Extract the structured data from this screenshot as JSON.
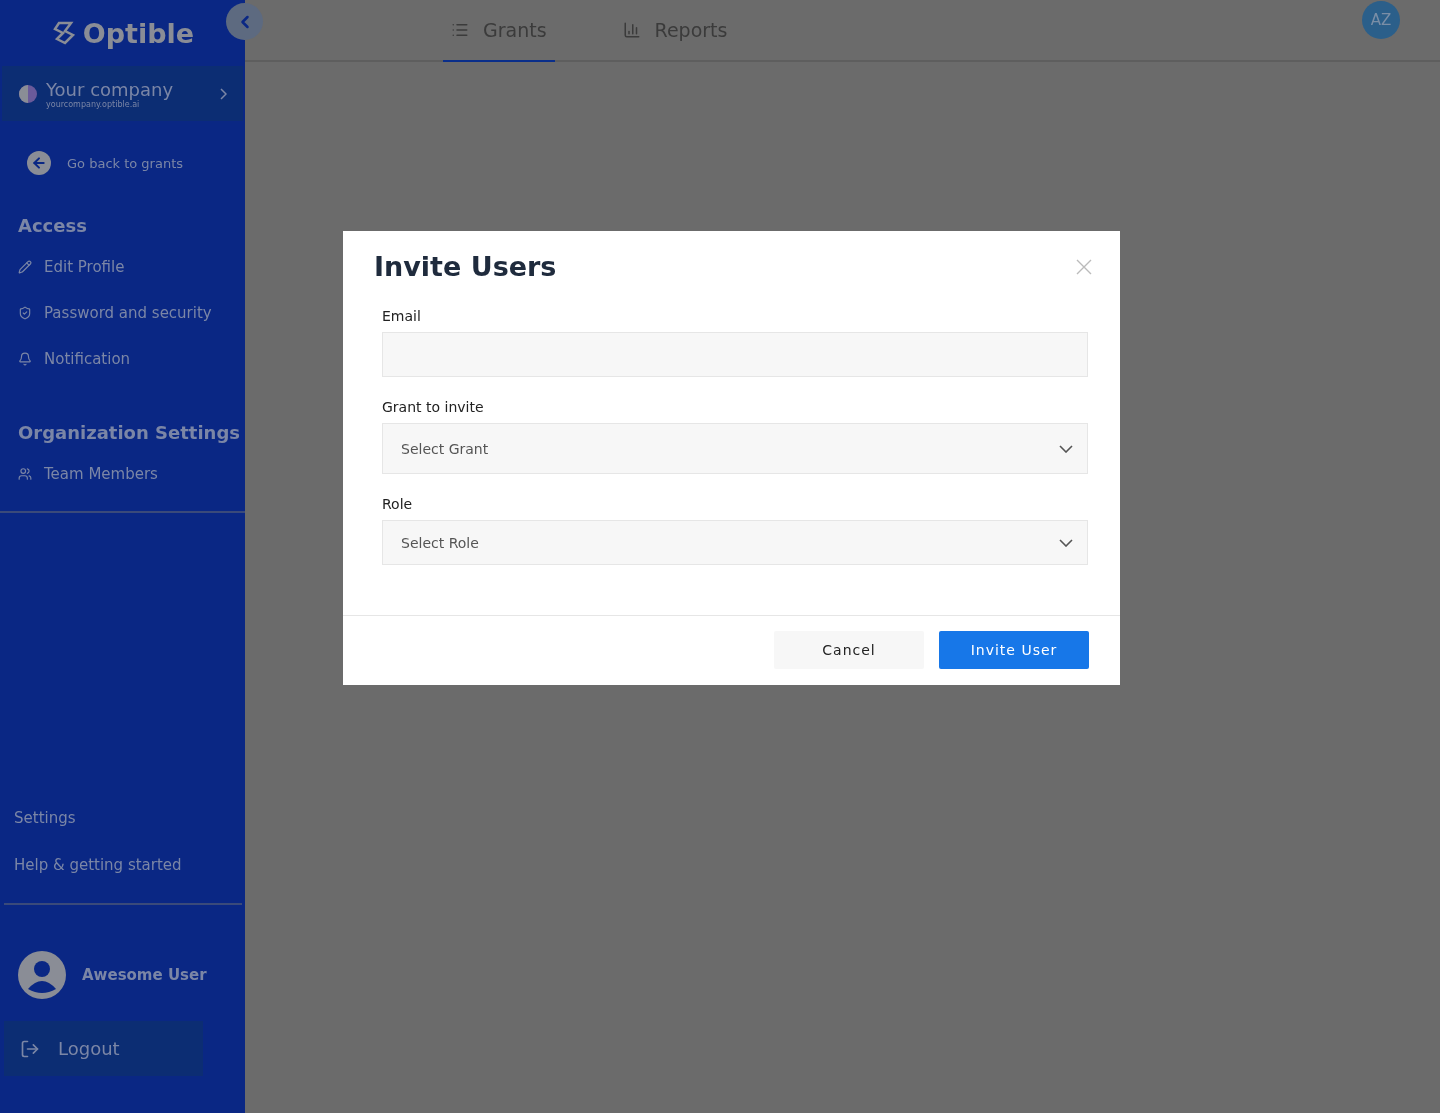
{
  "sidebar": {
    "logo": "Optible",
    "company": {
      "name": "Your company",
      "domain": "yourcompany.optible.ai"
    },
    "back_link": "Go back to grants",
    "sections": [
      {
        "title": "Access",
        "items": [
          {
            "label": "Edit Profile"
          },
          {
            "label": "Password and security"
          },
          {
            "label": "Notification"
          }
        ]
      },
      {
        "title": "Organization Settings",
        "items": [
          {
            "label": "Team Members"
          }
        ]
      }
    ],
    "footer_links": [
      "Settings",
      "Help & getting started"
    ],
    "user": {
      "name": "Awesome User"
    },
    "logout": "Logout"
  },
  "tabs": [
    {
      "label": "Grants",
      "selected": true
    },
    {
      "label": "Reports",
      "selected": false
    }
  ],
  "avatar": "AZ",
  "modal": {
    "title": "Invite Users",
    "fields": [
      {
        "kind": "text",
        "label": "Email"
      },
      {
        "kind": "select",
        "label": "Grant to invite",
        "placeholder": "Select Grant"
      },
      {
        "kind": "select",
        "label": "Role",
        "placeholder": "Select Role"
      }
    ],
    "buttons": [
      {
        "label": "Cancel",
        "kind": "secondary"
      },
      {
        "label": "Invite User",
        "kind": "primary"
      }
    ]
  }
}
